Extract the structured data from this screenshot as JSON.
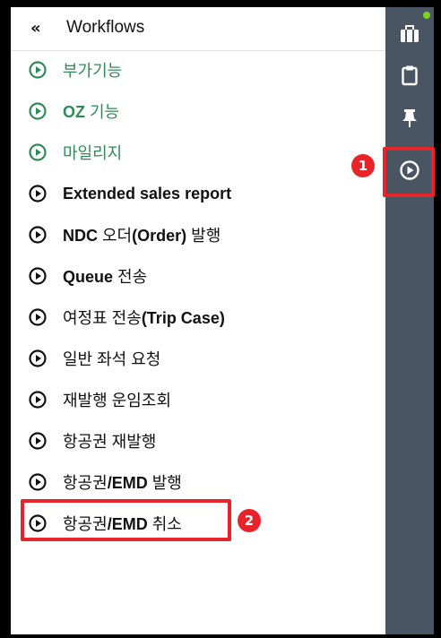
{
  "header": {
    "collapse_glyph": "«",
    "title": "Workflows"
  },
  "items": [
    {
      "pre": "",
      "bold": "",
      "post": "부가기능",
      "color": "#2e8b57"
    },
    {
      "pre": "",
      "bold": "OZ",
      "post": " 기능",
      "color": "#2e8b57"
    },
    {
      "pre": "",
      "bold": "",
      "post": "마일리지",
      "color": "#2e8b57"
    },
    {
      "pre": "",
      "bold": "Extended sales report",
      "post": "",
      "color": "#111111"
    },
    {
      "pre": "",
      "bold": "NDC",
      "post": " 오더",
      "bold2": "(Order)",
      "post2": " 발행",
      "color": "#111111"
    },
    {
      "pre": "",
      "bold": "Queue",
      "post": " 전송",
      "color": "#111111"
    },
    {
      "pre": "여정표 전송",
      "bold": "(Trip Case)",
      "post": "",
      "color": "#111111"
    },
    {
      "pre": "일반 좌석 요청",
      "bold": "",
      "post": "",
      "color": "#111111"
    },
    {
      "pre": "재발행 운임조회",
      "bold": "",
      "post": "",
      "color": "#111111"
    },
    {
      "pre": "항공권 재발행",
      "bold": "",
      "post": "",
      "color": "#111111"
    },
    {
      "pre": "항공권",
      "bold": "/EMD",
      "post": " 발행",
      "color": "#111111"
    },
    {
      "pre": "항공권",
      "bold": "/EMD",
      "post": " 취소",
      "color": "#111111"
    }
  ],
  "rail": {
    "icons": [
      "briefcase-icon",
      "clipboard-icon",
      "pin-icon",
      "play-circle-icon"
    ]
  },
  "annotations": {
    "badge1": "1",
    "badge2": "2"
  },
  "colors": {
    "accent_green": "#2e8b57",
    "highlight_red": "#e8232a",
    "rail_bg": "#4a5563",
    "notify_green": "#7ed321"
  }
}
